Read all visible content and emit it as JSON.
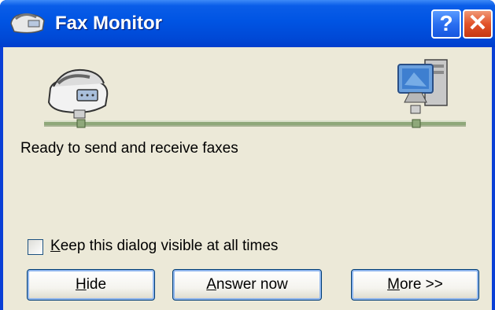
{
  "window": {
    "title": "Fax Monitor",
    "help_label": "?",
    "close_label": "✕"
  },
  "status": {
    "text": "Ready to send and receive faxes"
  },
  "options": {
    "keep_visible_key": "K",
    "keep_visible_rest": "eep this dialog visible at all times",
    "keep_visible_checked": false
  },
  "buttons": {
    "hide_key": "H",
    "hide_rest": "ide",
    "answer_key": "A",
    "answer_rest": "nswer now",
    "more_key": "M",
    "more_rest": "ore >>"
  },
  "colors": {
    "titlebar": "#0054e3",
    "client_bg": "#ece9d8",
    "network_line": "#8fa87a"
  }
}
